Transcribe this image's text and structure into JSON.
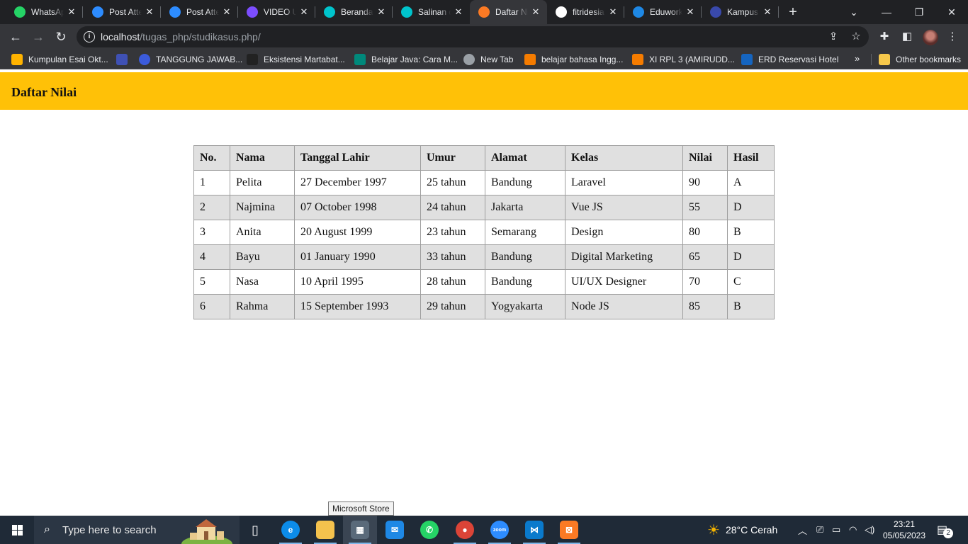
{
  "browser": {
    "tabs": [
      {
        "title": "WhatsApp",
        "icon": "whatsapp-icon",
        "color": "#25d366"
      },
      {
        "title": "Post Attendance",
        "icon": "zoom-z-icon",
        "color": "#2d8cff"
      },
      {
        "title": "Post Attendance",
        "icon": "zoom-z-icon",
        "color": "#2d8cff"
      },
      {
        "title": "VIDEO UPLOAD",
        "icon": "video-icon",
        "color": "#7c4dff"
      },
      {
        "title": "Beranda",
        "icon": "canva-icon",
        "color": "#00c4cc"
      },
      {
        "title": "Salinan dari",
        "icon": "canva-icon",
        "color": "#00c4cc"
      },
      {
        "title": "Daftar Nilai",
        "icon": "xampp-icon",
        "color": "#fb7a24"
      },
      {
        "title": "fitridesiana",
        "icon": "github-icon",
        "color": "#ffffff"
      },
      {
        "title": "Eduwork",
        "icon": "eduwork-icon",
        "color": "#1e88e5"
      },
      {
        "title": "Kampus Merdeka",
        "icon": "kampus-icon",
        "color": "#3949ab"
      }
    ],
    "active_tab_index": 6,
    "url": {
      "host": "localhost",
      "path": "/tugas_php/studikasus.php/"
    },
    "bookmarks": [
      {
        "label": "Kumpulan Esai Okt...",
        "icon": "doc-icon",
        "color": "#ffb300"
      },
      {
        "label": "",
        "icon": "graduation-cap-icon",
        "color": "#3f51b5"
      },
      {
        "label": "TANGGUNG JAWAB...",
        "icon": "globe-ring-icon",
        "color": "#3b5bdb"
      },
      {
        "label": "Eksistensi Martabat...",
        "icon": "feather-icon",
        "color": "#222222"
      },
      {
        "label": "Belajar Java: Cara M...",
        "icon": "java-icon",
        "color": "#00897b"
      },
      {
        "label": "New Tab",
        "icon": "globe-icon",
        "color": "#9aa0a6"
      },
      {
        "label": "belajar bahasa Ingg...",
        "icon": "blogger-icon",
        "color": "#f57c00"
      },
      {
        "label": "XI RPL 3 (AMIRUDD...",
        "icon": "blogger-icon",
        "color": "#f57c00"
      },
      {
        "label": "ERD Reservasi Hotel",
        "icon": "d-icon",
        "color": "#1565c0"
      }
    ],
    "other_bookmarks": "Other bookmarks"
  },
  "page": {
    "title": "Daftar Nilai",
    "header_color": "#ffc107",
    "table": {
      "headers": [
        "No.",
        "Nama",
        "Tanggal Lahir",
        "Umur",
        "Alamat",
        "Kelas",
        "Nilai",
        "Hasil"
      ],
      "rows": [
        [
          "1",
          "Pelita",
          "27 December 1997",
          "25 tahun",
          "Bandung",
          "Laravel",
          "90",
          "A"
        ],
        [
          "2",
          "Najmina",
          "07 October 1998",
          "24 tahun",
          "Jakarta",
          "Vue JS",
          "55",
          "D"
        ],
        [
          "3",
          "Anita",
          "20 August 1999",
          "23 tahun",
          "Semarang",
          "Design",
          "80",
          "B"
        ],
        [
          "4",
          "Bayu",
          "01 January 1990",
          "33 tahun",
          "Bandung",
          "Digital Marketing",
          "65",
          "D"
        ],
        [
          "5",
          "Nasa",
          "10 April 1995",
          "28 tahun",
          "Bandung",
          "UI/UX Designer",
          "70",
          "C"
        ],
        [
          "6",
          "Rahma",
          "15 September 1993",
          "29 tahun",
          "Yogyakarta",
          "Node JS",
          "85",
          "B"
        ]
      ]
    }
  },
  "taskbar": {
    "search_placeholder": "Type here to search",
    "tooltip": "Microsoft Store",
    "apps": [
      {
        "name": "task-view-icon",
        "color": "transparent",
        "glyph": "▯"
      },
      {
        "name": "edge-icon",
        "color": "#0c8ce9",
        "glyph": "e"
      },
      {
        "name": "file-explorer-icon",
        "color": "#f4c24d",
        "glyph": ""
      },
      {
        "name": "microsoft-store-icon",
        "color": "#5a6a7a",
        "glyph": "▦"
      },
      {
        "name": "mail-icon",
        "color": "#1e88e5",
        "glyph": "✉"
      },
      {
        "name": "whatsapp-icon",
        "color": "#25d366",
        "glyph": "✆"
      },
      {
        "name": "chrome-icon",
        "color": "#db4437",
        "glyph": "●"
      },
      {
        "name": "zoom-icon",
        "color": "#2d8cff",
        "glyph": "zoom"
      },
      {
        "name": "vscode-icon",
        "color": "#0a7acc",
        "glyph": "⋈"
      },
      {
        "name": "xampp-icon",
        "color": "#fb7a24",
        "glyph": "⊠"
      }
    ],
    "weather": "28°C  Cerah",
    "time": "23:21",
    "date": "05/05/2023",
    "notification_count": "2"
  }
}
